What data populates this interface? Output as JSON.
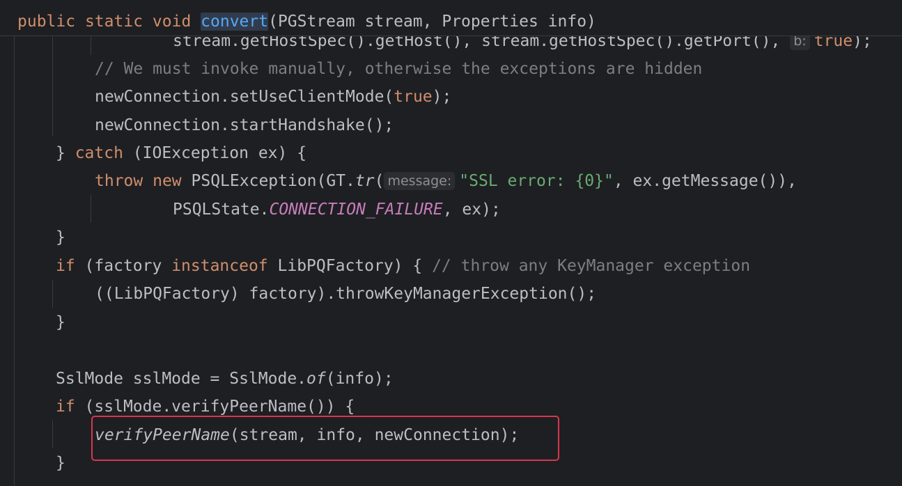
{
  "header": {
    "peek_text": "                    stream.getHostSpec().getHost(), stream.getH",
    "kw_public": "public",
    "kw_static": "static",
    "kw_void": "void",
    "method_name": "convert",
    "params": "(PGStream stream, Properties info)"
  },
  "lines": {
    "l1": {
      "a": "stream.getHostSpec().getHost(), stream.getHostSpec().getPort(),",
      "hint": "b:",
      "kw": "true",
      "end": ");"
    },
    "l2": {
      "comment": "// We must invoke manually, otherwise the exceptions are hidden"
    },
    "l3": {
      "a": "newConnection.setUseClientMode(",
      "kw": "true",
      "end": ");"
    },
    "l4": {
      "a": "newConnection.startHandshake();"
    },
    "l5": {
      "a": "} ",
      "kw": "catch",
      "end": " (IOException ex) {"
    },
    "l6": {
      "kw1": "throw",
      "kw2": "new",
      "a": "PSQLException(GT.",
      "fn": "tr",
      "paren": "(",
      "hint": "message:",
      "str": "\"SSL error: {0}\"",
      "end": ", ex.getMessage()),"
    },
    "l7": {
      "a": "PSQLState.",
      "const": "CONNECTION_FAILURE",
      "end": ", ex);"
    },
    "l8": {
      "a": "}"
    },
    "l9": {
      "kw1": "if",
      "a": " (factory ",
      "kw2": "instanceof",
      "b": " LibPQFactory) { ",
      "comment": "// throw any KeyManager exception"
    },
    "l10": {
      "a": "((LibPQFactory) factory).throwKeyManagerException();"
    },
    "l11": {
      "a": "}"
    },
    "l12": {
      "a": "SslMode sslMode = SslMode.",
      "it": "of",
      "end": "(info);"
    },
    "l13": {
      "kw": "if",
      "a": " (sslMode.verifyPeerName()) {"
    },
    "l14": {
      "it": "verifyPeerName",
      "a": "(stream, info, newConnection);"
    },
    "l15": {
      "a": "}"
    }
  },
  "colors": {
    "background": "#1e1f22",
    "keyword": "#cf8e6d",
    "method": "#56a8f5",
    "string": "#6aab73",
    "comment": "#7a7e85",
    "constant": "#c77dbb",
    "highlight_box": "#d9364f"
  }
}
